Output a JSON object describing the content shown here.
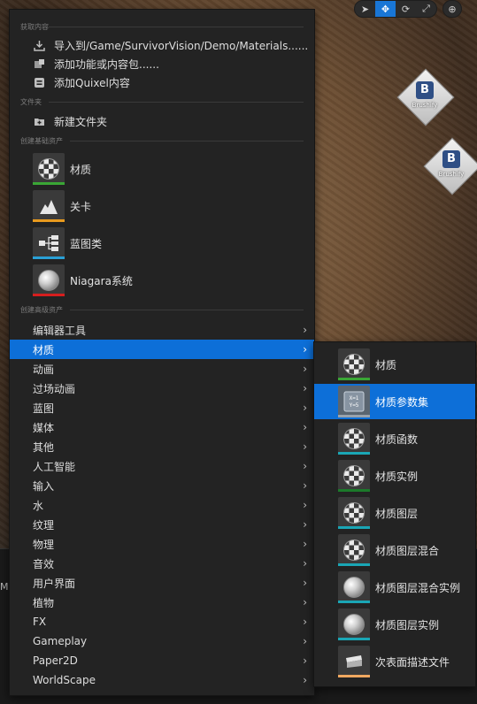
{
  "colors": {
    "selection": "#0d6fd8",
    "menu_bg": "#232323",
    "material_bar": "#3aa635",
    "level_bar": "#e89a1e",
    "blueprint_bar": "#2aa0d6",
    "niagara_bar": "#d61e1e",
    "function_bar": "#1aa6b5",
    "instance_bar": "#1b7a2a",
    "profile_bar": "#f0a860"
  },
  "toolbar": {
    "items": [
      {
        "icon": "select-arrow-icon",
        "glyph": "➤"
      },
      {
        "icon": "translate-icon",
        "glyph": "✥"
      },
      {
        "icon": "rotate-icon",
        "glyph": "⟳"
      },
      {
        "icon": "scale-icon",
        "glyph": "⤢"
      },
      {
        "icon": "world-local-icon",
        "glyph": "⊕"
      }
    ]
  },
  "viewport": {
    "brushify_label": "Brushify",
    "brushify_badge": "B",
    "bottom_text": "Ma"
  },
  "menu": {
    "section_get_content": "获取内容",
    "import_label": "导入到/Game/SurvivorVision/Demo/Materials......",
    "add_feature_label": "添加功能或内容包......",
    "add_quixel_label": "添加Quixel内容",
    "section_folder": "文件夹",
    "new_folder_label": "新建文件夹",
    "section_basic_assets": "创建基础资产",
    "basic_assets": [
      {
        "name": "材质",
        "icon": "material-icon",
        "color": "#3aa635"
      },
      {
        "name": "关卡",
        "icon": "level-icon",
        "color": "#e89a1e"
      },
      {
        "name": "蓝图类",
        "icon": "blueprint-icon",
        "color": "#2aa0d6"
      },
      {
        "name": "Niagara系统",
        "icon": "niagara-icon",
        "color": "#d61e1e"
      }
    ],
    "section_advanced_assets": "创建高级资产",
    "categories": [
      {
        "label": "编辑器工具",
        "selected": false
      },
      {
        "label": "材质",
        "selected": true
      },
      {
        "label": "动画",
        "selected": false
      },
      {
        "label": "过场动画",
        "selected": false
      },
      {
        "label": "蓝图",
        "selected": false
      },
      {
        "label": "媒体",
        "selected": false
      },
      {
        "label": "其他",
        "selected": false
      },
      {
        "label": "人工智能",
        "selected": false
      },
      {
        "label": "输入",
        "selected": false
      },
      {
        "label": "水",
        "selected": false
      },
      {
        "label": "纹理",
        "selected": false
      },
      {
        "label": "物理",
        "selected": false
      },
      {
        "label": "音效",
        "selected": false
      },
      {
        "label": "用户界面",
        "selected": false
      },
      {
        "label": "植物",
        "selected": false
      },
      {
        "label": "FX",
        "selected": false
      },
      {
        "label": "Gameplay",
        "selected": false
      },
      {
        "label": "Paper2D",
        "selected": false
      },
      {
        "label": "WorldScape",
        "selected": false
      }
    ],
    "chevron": "›"
  },
  "submenu": {
    "items": [
      {
        "name": "材质",
        "icon": "material-icon",
        "color": "#3aa635",
        "selected": false
      },
      {
        "name": "材质参数集",
        "icon": "parameter-collection-icon",
        "color": "#9aa3ad",
        "selected": true
      },
      {
        "name": "材质函数",
        "icon": "material-function-icon",
        "color": "#1aa6b5",
        "selected": false
      },
      {
        "name": "材质实例",
        "icon": "material-instance-icon",
        "color": "#1b7a2a",
        "selected": false
      },
      {
        "name": "材质图层",
        "icon": "material-layer-icon",
        "color": "#1aa6b5",
        "selected": false
      },
      {
        "name": "材质图层混合",
        "icon": "material-layer-blend-icon",
        "color": "#1aa6b5",
        "selected": false
      },
      {
        "name": "材质图层混合实例",
        "icon": "material-layer-blend-instance-icon",
        "color": "#1aa6b5",
        "selected": false
      },
      {
        "name": "材质图层实例",
        "icon": "material-layer-instance-icon",
        "color": "#1aa6b5",
        "selected": false
      },
      {
        "name": "次表面描述文件",
        "icon": "subsurface-profile-icon",
        "color": "#f0a860",
        "selected": false
      }
    ],
    "param_glyph": "X=1 Y=5"
  }
}
